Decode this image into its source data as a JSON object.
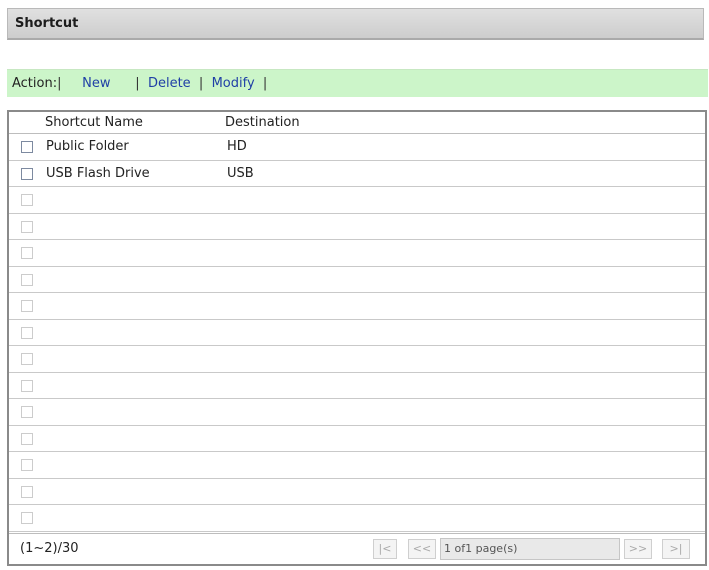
{
  "title": "Shortcut",
  "action_bar": {
    "label": "Action:",
    "links": {
      "new": "New",
      "delete": "Delete",
      "modify": "Modify"
    }
  },
  "table": {
    "columns": {
      "name": "Shortcut Name",
      "destination": "Destination"
    },
    "rows": [
      {
        "name": "Public Folder",
        "destination": "HD"
      },
      {
        "name": "USB Flash Drive",
        "destination": "USB"
      }
    ]
  },
  "footer": {
    "range": "(1~2)/30",
    "page_info": "1 of1 page(s)",
    "buttons": {
      "first": "|<",
      "prev": "<<",
      "next": ">>",
      "last": ">|"
    }
  }
}
